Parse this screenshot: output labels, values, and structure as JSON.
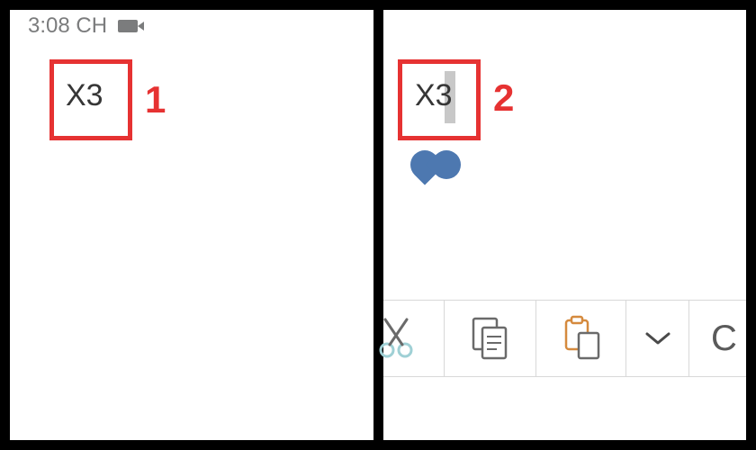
{
  "status_bar": {
    "time": "3:08 CH",
    "camera_icon": "camera-icon"
  },
  "left_panel": {
    "cell_text": "X3",
    "callout_number": "1"
  },
  "right_panel": {
    "cell_text": "X3",
    "callout_number": "2",
    "selection_handle_icon": "teardrop-handle-icon"
  },
  "toolbar": {
    "cut_icon": "scissors-icon",
    "copy_icon": "copy-icon",
    "paste_icon": "clipboard-paste-icon",
    "expand_icon": "chevron-down-icon",
    "last_partial": "C"
  },
  "colors": {
    "highlight_red": "#e63232",
    "handle_blue": "#4d78b0",
    "icon_grey": "#6a6a6a",
    "scissor_teal": "#9fd0d5",
    "paste_orange": "#d58a3e"
  }
}
